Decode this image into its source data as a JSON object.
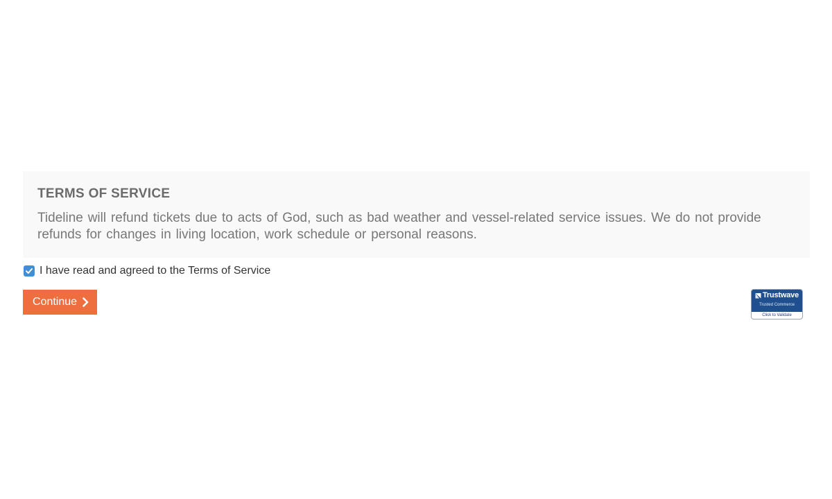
{
  "terms": {
    "title": "TERMS OF SERVICE",
    "body": "Tideline will refund tickets due to acts of God, such as bad weather and vessel-related service issues. We do not provide refunds for changes in living location, work schedule or personal reasons."
  },
  "agreement": {
    "label": "I have read and agreed to the Terms of Service",
    "checked": true
  },
  "continue_button": {
    "label": "Continue",
    "icon": "chevron-right-icon"
  },
  "trust_badge": {
    "brand": "Trustwave",
    "subtitle": "Trusted Commerce",
    "action": "Click to Validate"
  },
  "colors": {
    "accent": "#ee6e3f",
    "checkbox": "#3f8fd7",
    "panel_bg": "#f9f9f9",
    "badge_blue": "#1f4f8f"
  }
}
